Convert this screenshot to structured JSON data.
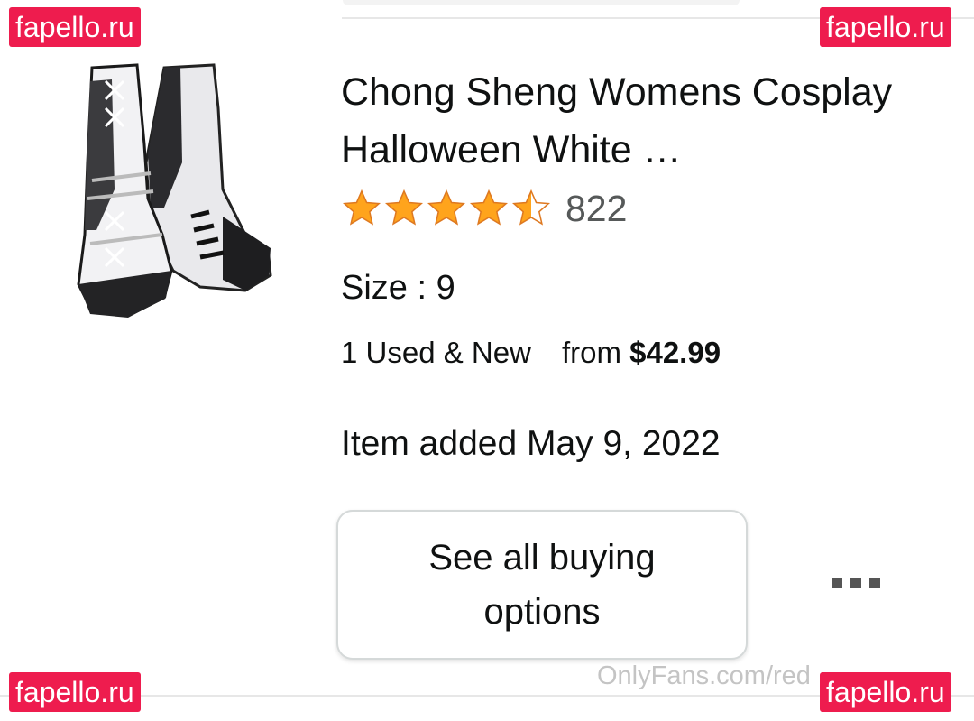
{
  "product": {
    "title": "Chong Sheng Womens Cosplay Halloween White …",
    "rating_stars": 4.5,
    "rating_count": "822",
    "size_label": "Size : 9",
    "offers_label": "1 Used & New",
    "price_prefix": "from",
    "price": "$42.99",
    "added_label": "Item added May 9, 2022",
    "image_icon": "boot-product-image"
  },
  "actions": {
    "buy_button_label": "See all buying options",
    "more_icon": "more-options-icon"
  },
  "watermarks": {
    "site": "fapello.ru",
    "bottom_text": "OnlyFans.com/red"
  },
  "colors": {
    "star": "#ffa41c",
    "watermark_bg": "#ee1c4e",
    "price_text": "#0f1111"
  }
}
